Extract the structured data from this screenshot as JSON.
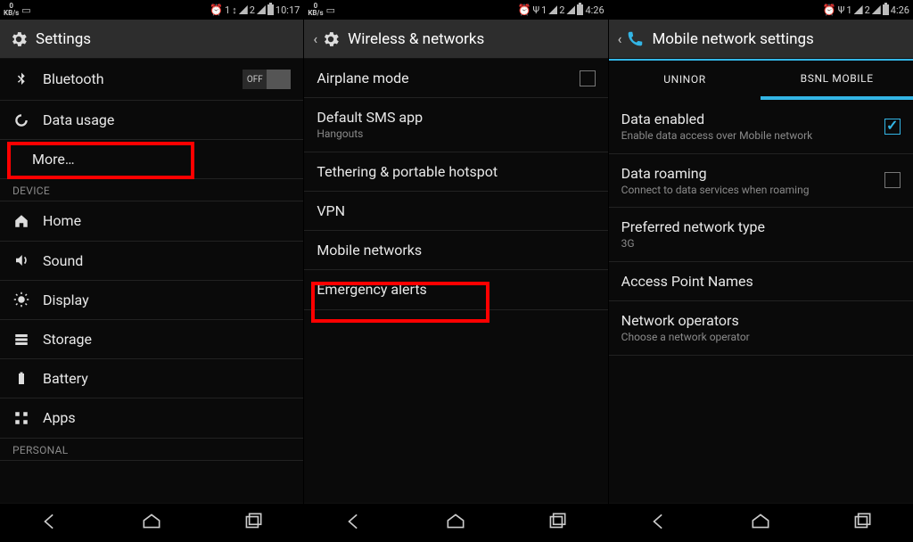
{
  "status": {
    "kbs": "0",
    "kbs_unit": "KB/s",
    "alarm": "⏰",
    "sim1": "1",
    "sim2": "2",
    "time_a": "10:17",
    "time_b": "4:26",
    "time_c": "4:26",
    "wifi": "✶",
    "psi": "Ψ"
  },
  "c1": {
    "title": "Settings",
    "rows": {
      "bt": "Bluetooth",
      "bt_state": "OFF",
      "data": "Data usage",
      "more": "More…",
      "sect_device": "DEVICE",
      "home": "Home",
      "sound": "Sound",
      "display": "Display",
      "storage": "Storage",
      "battery": "Battery",
      "apps": "Apps",
      "sect_personal": "PERSONAL"
    }
  },
  "c2": {
    "title": "Wireless & networks",
    "rows": {
      "airplane": "Airplane mode",
      "sms": "Default SMS app",
      "sms_sub": "Hangouts",
      "tether": "Tethering & portable hotspot",
      "vpn": "VPN",
      "mobile": "Mobile networks",
      "alerts": "Emergency alerts"
    }
  },
  "c3": {
    "title": "Mobile network settings",
    "tabs": {
      "t1": "UNINOR",
      "t2": "BSNL MOBILE"
    },
    "rows": {
      "de_t": "Data enabled",
      "de_s": "Enable data access over Mobile network",
      "dr_t": "Data roaming",
      "dr_s": "Connect to data services when roaming",
      "pnt_t": "Preferred network type",
      "pnt_s": "3G",
      "apn": "Access Point Names",
      "op_t": "Network operators",
      "op_s": "Choose a network operator"
    }
  }
}
